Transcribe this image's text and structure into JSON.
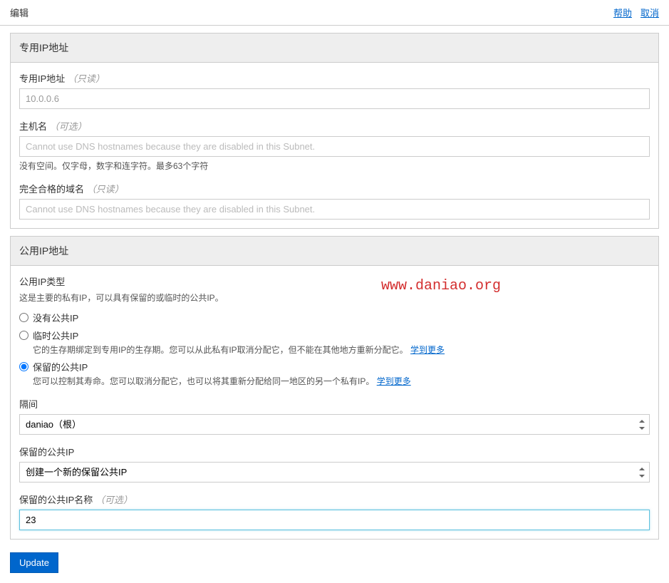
{
  "top": {
    "title": "编辑",
    "help": "帮助",
    "cancel": "取消"
  },
  "panel1": {
    "title": "专用IP地址",
    "private_ip": {
      "label": "专用IP地址",
      "hint": "（只读）",
      "value": "10.0.0.6"
    },
    "hostname": {
      "label": "主机名",
      "hint": "（可选）",
      "placeholder": "Cannot use DNS hostnames because they are disabled in this Subnet.",
      "help": "没有空间。仅字母，数字和连字符。最多63个字符"
    },
    "fqdn": {
      "label": "完全合格的域名",
      "hint": "（只读）",
      "placeholder": "Cannot use DNS hostnames because they are disabled in this Subnet."
    }
  },
  "panel2": {
    "title": "公用IP地址",
    "type": {
      "label": "公用IP类型",
      "desc": "这是主要的私有IP，可以具有保留的或临时的公共IP。"
    },
    "radio": {
      "none": "没有公共IP",
      "ephemeral": {
        "label": "临时公共IP",
        "desc": "它的生存期绑定到专用IP的生存期。您可以从此私有IP取消分配它，但不能在其他地方重新分配它。",
        "learn": "学到更多"
      },
      "reserved": {
        "label": "保留的公共IP",
        "desc": "您可以控制其寿命。您可以取消分配它，也可以将其重新分配给同一地区的另一个私有IP。",
        "learn": "学到更多"
      }
    },
    "compartment": {
      "label": "隔间",
      "value": "daniao（根）"
    },
    "reserved_ip": {
      "label": "保留的公共IP",
      "value": "创建一个新的保留公共IP"
    },
    "reserved_name": {
      "label": "保留的公共IP名称",
      "hint": "（可选）",
      "value": "23"
    }
  },
  "watermark": "www.daniao.org",
  "update": "Update"
}
